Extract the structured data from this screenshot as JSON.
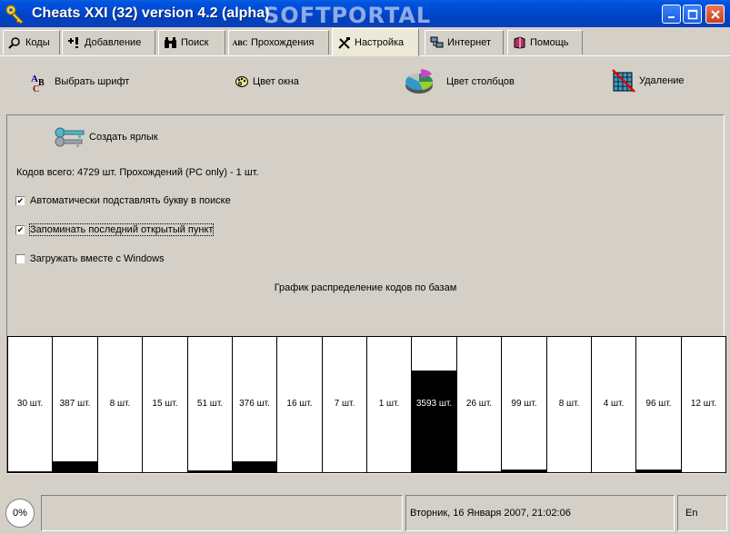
{
  "window": {
    "title": "Cheats XXI (32)  version 4.2 (alpha)",
    "watermark": "SOFTPORTAL"
  },
  "tabs": [
    {
      "label": "Коды",
      "icon": "magnifier-icon"
    },
    {
      "label": "Добавление",
      "icon": "add-icon"
    },
    {
      "label": "Поиск",
      "icon": "binoculars-icon"
    },
    {
      "label": "Прохождения",
      "icon": "abc-icon"
    },
    {
      "label": "Настройка",
      "icon": "tools-icon",
      "active": true
    },
    {
      "label": "Интернет",
      "icon": "network-icon"
    },
    {
      "label": "Помощь",
      "icon": "book-icon"
    }
  ],
  "settings": {
    "font_label": "Выбрать шрифт",
    "window_color_label": "Цвет окна",
    "bar_color_label": "Цвет столбцов",
    "delete_label": "Удаление"
  },
  "panel": {
    "shortcut_label": "Создать ярлык",
    "info": "Кодов всего:  4729 шт.  Прохождений (PC only) - 1 шт.",
    "checkboxes": [
      {
        "label": "Автоматически подставлять букву в поиске",
        "checked": true
      },
      {
        "label": "Запоминать последний открытый пункт",
        "checked": true
      },
      {
        "label": "Загружать вместе с Windows",
        "checked": false
      }
    ],
    "graph_title": "График распределение кодов по базам"
  },
  "chart_data": {
    "type": "bar",
    "title": "График распределение кодов по базам",
    "values": [
      30,
      387,
      8,
      15,
      51,
      376,
      16,
      7,
      1,
      3593,
      26,
      99,
      8,
      4,
      96,
      12
    ],
    "labels": [
      "30 шт.",
      "387 шт.",
      "8 шт.",
      "15 шт.",
      "51 шт.",
      "376 шт.",
      "16 шт.",
      "7 шт.",
      "1 шт.",
      "3593 шт.",
      "26 шт.",
      "99 шт.",
      "8 шт.",
      "4 шт.",
      "96 шт.",
      "12 шт."
    ],
    "ylim": [
      0,
      3593
    ]
  },
  "status": {
    "progress": "0%",
    "datetime": "Вторник, 16 Января 2007, 21:02:06",
    "language": "En"
  }
}
